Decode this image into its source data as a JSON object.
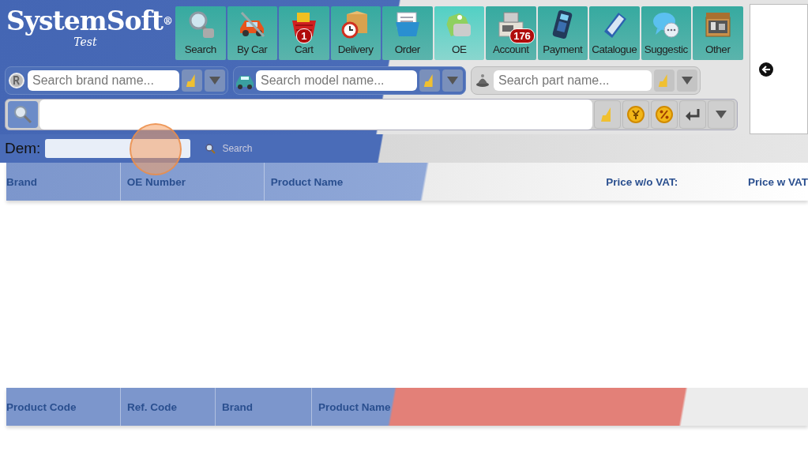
{
  "logo": {
    "name": "SystemSoft",
    "mark": "®",
    "subtitle": "Test"
  },
  "toolbar": [
    {
      "label": "Search",
      "selected": false
    },
    {
      "label": "By Car",
      "selected": false
    },
    {
      "label": "Cart",
      "badge": "1",
      "selected": false
    },
    {
      "label": "Delivery",
      "selected": false
    },
    {
      "label": "Order",
      "selected": false
    },
    {
      "label": "OE",
      "selected": true
    },
    {
      "label": "Account",
      "badge": "176",
      "selected": false
    },
    {
      "label": "Payment",
      "selected": false
    },
    {
      "label": "Catalogue",
      "selected": false
    },
    {
      "label": "Suggestic",
      "selected": false
    },
    {
      "label": "Other",
      "selected": false
    }
  ],
  "search_fields": [
    {
      "placeholder": "Search brand name..."
    },
    {
      "placeholder": "Search model name..."
    },
    {
      "placeholder": "Search part name..."
    }
  ],
  "oem_filter": {
    "label": "Dem:",
    "link": "Search"
  },
  "results_table": {
    "columns": [
      "Brand",
      "OE Number",
      "Product Name",
      "Price w/o VAT:",
      "Price w VAT"
    ]
  },
  "cross_table": {
    "columns": [
      "Product Code",
      "Ref. Code",
      "Brand",
      "Product Name"
    ]
  }
}
